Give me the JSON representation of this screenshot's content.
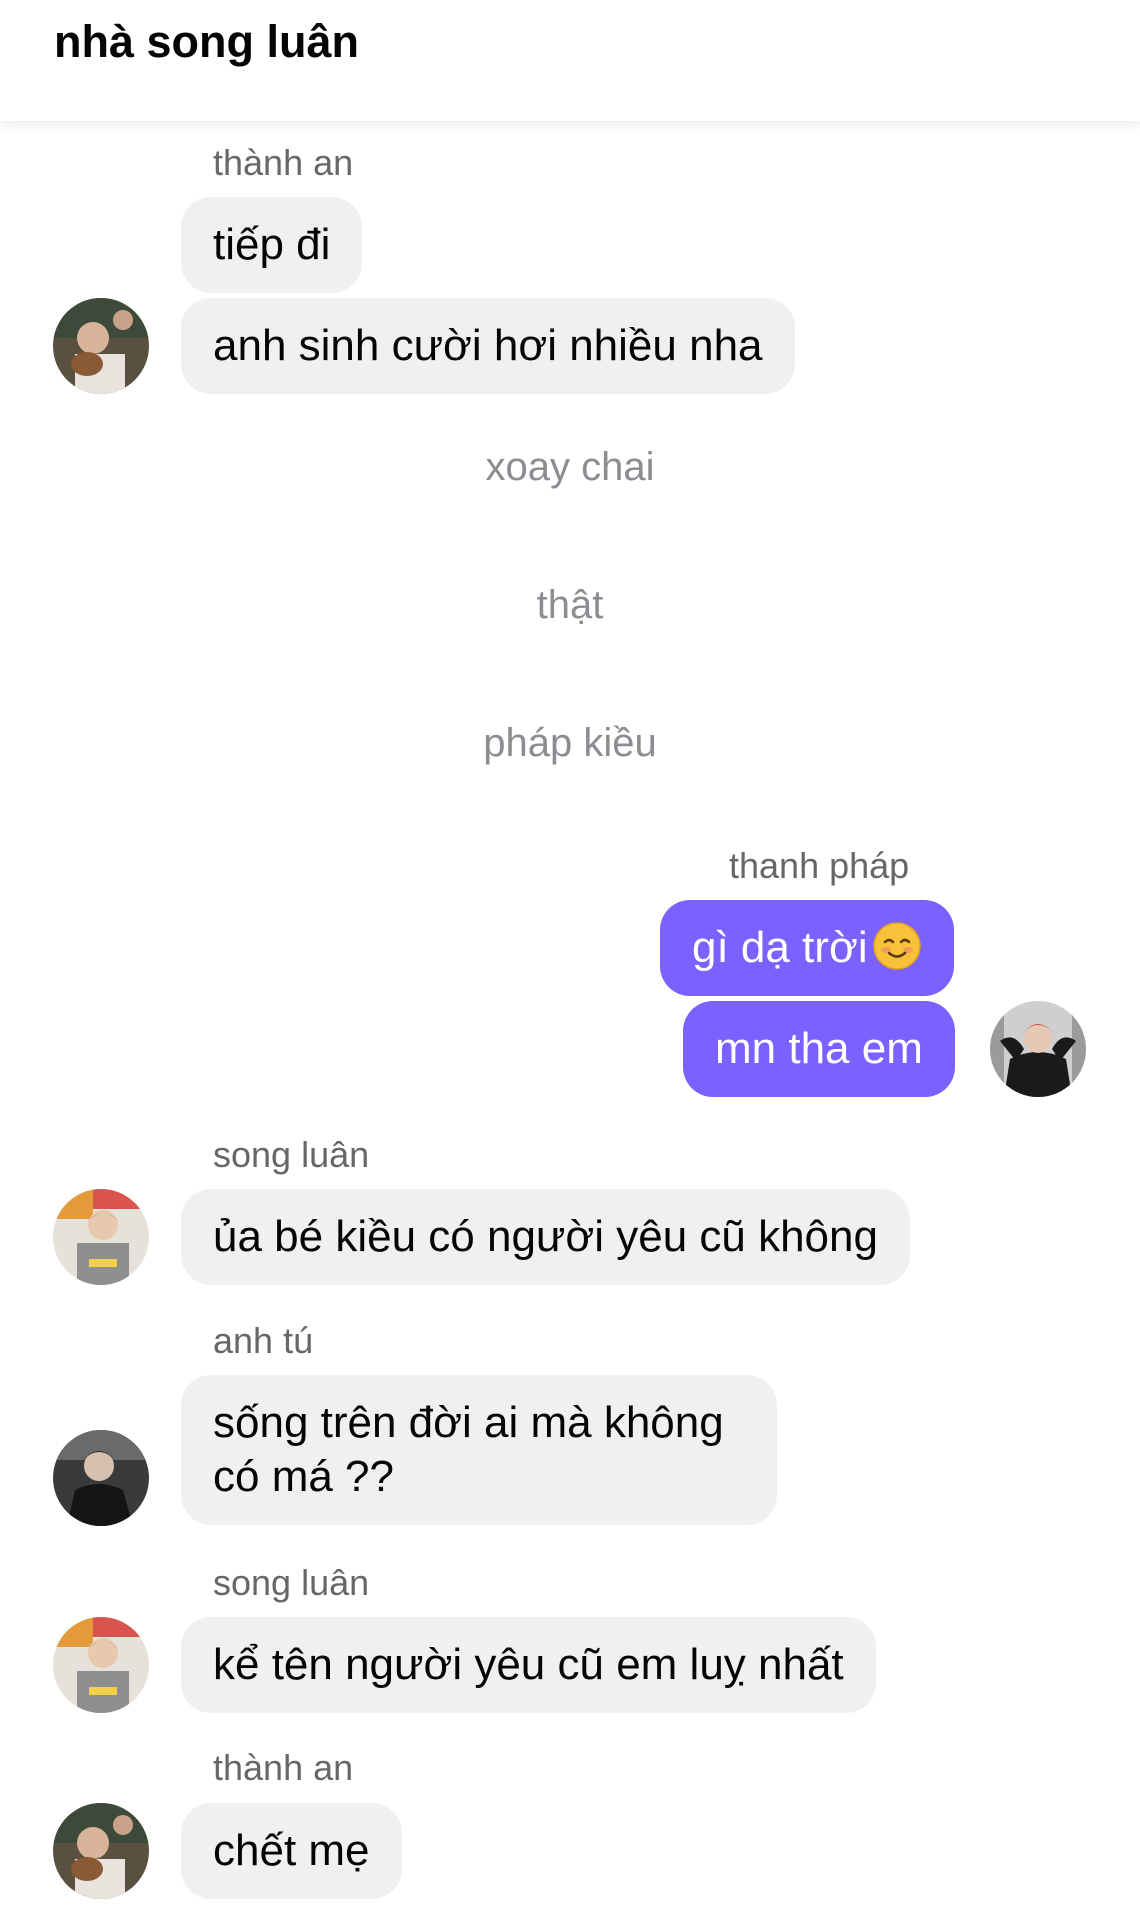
{
  "header": {
    "title": "nhà song luân"
  },
  "messages": [
    {
      "sender": "thành an",
      "bubbles": [
        "tiếp đi",
        "anh sinh cười hơi nhiều nha"
      ]
    },
    {
      "notes": [
        "xoay chai",
        "thật",
        "pháp kiều"
      ]
    },
    {
      "sender": "thanh pháp",
      "bubbles": [
        "gì dạ trời",
        "mn tha em"
      ],
      "emoji": "smiling-face-icon"
    },
    {
      "sender": "song luân",
      "bubbles": [
        "ủa bé kiều có người yêu cũ không"
      ]
    },
    {
      "sender": "anh tú",
      "bubbles": [
        "sống trên đời ai mà không",
        "có má ??"
      ]
    },
    {
      "sender": "song luân",
      "bubbles": [
        "kể tên người yêu cũ em luỵ nhất"
      ]
    },
    {
      "sender": "thành an",
      "bubbles": [
        "chết mẹ"
      ]
    }
  ],
  "colors": {
    "outgoing_bubble": "#7b61ff",
    "incoming_bubble": "#f0f0f0",
    "sender_name": "#65676b",
    "note_text": "#8a8d91"
  }
}
